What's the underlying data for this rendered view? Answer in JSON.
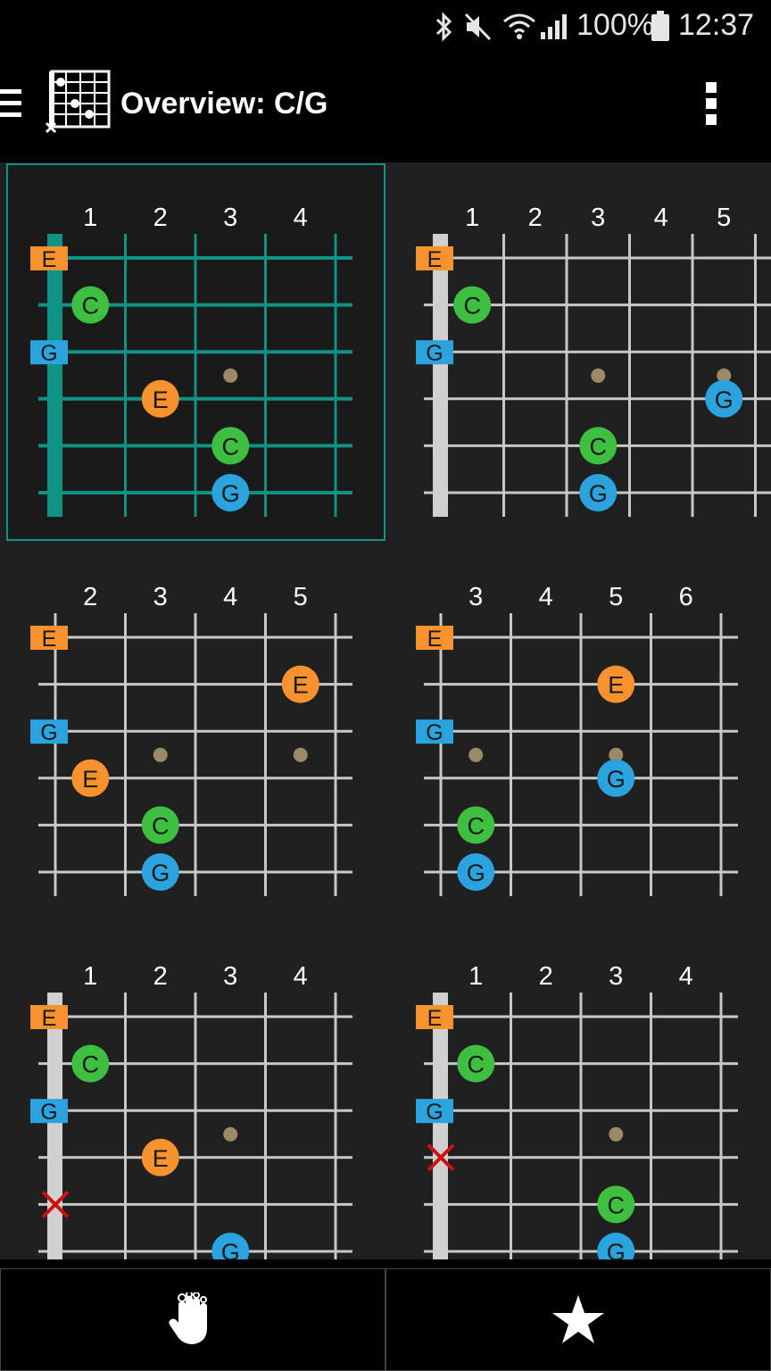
{
  "status_bar": {
    "icons": [
      "bluetooth-icon",
      "mute-icon",
      "wifi-icon",
      "signal-icon",
      "battery-icon"
    ],
    "battery": "100%",
    "time": "12:37"
  },
  "app_bar": {
    "menu_icon": "hamburger-menu-icon",
    "app_icon": "chord-diagram-icon",
    "title": "Overview: C/G",
    "overflow_icon": "more-vertical-icon"
  },
  "colors": {
    "E": "#f7922f",
    "C": "#3fbf3f",
    "G": "#2aa3de",
    "selected": "#0f9384",
    "fret": "#c8c8c8",
    "marker_dot": "#9a8a66",
    "mute_x": "#cc1111"
  },
  "open_string_labels": [
    "E",
    "",
    "G",
    "",
    "",
    ""
  ],
  "diagrams": [
    {
      "selected": true,
      "nut": true,
      "fret_numbers": [
        "1",
        "2",
        "3",
        "4"
      ],
      "inlays": [
        {
          "string": 4,
          "fret": 3
        }
      ],
      "notes": [
        {
          "string": 2,
          "fret": 1,
          "label": "C"
        },
        {
          "string": 4,
          "fret": 2,
          "label": "E"
        },
        {
          "string": 5,
          "fret": 3,
          "label": "C"
        },
        {
          "string": 6,
          "fret": 3,
          "label": "G"
        }
      ],
      "muted": []
    },
    {
      "selected": false,
      "nut": true,
      "fret_numbers": [
        "1",
        "2",
        "3",
        "4",
        "5"
      ],
      "inlays": [
        {
          "string": 4,
          "fret": 3
        },
        {
          "string": 4,
          "fret": 5
        }
      ],
      "notes": [
        {
          "string": 2,
          "fret": 1,
          "label": "C"
        },
        {
          "string": 4,
          "fret": 5,
          "label": "G"
        },
        {
          "string": 5,
          "fret": 3,
          "label": "C"
        },
        {
          "string": 6,
          "fret": 3,
          "label": "G"
        }
      ],
      "muted": []
    },
    {
      "selected": false,
      "nut": false,
      "fret_numbers": [
        "2",
        "3",
        "4",
        "5"
      ],
      "inlays": [
        {
          "string": 4,
          "fret": 2
        },
        {
          "string": 4,
          "fret": 4
        }
      ],
      "notes": [
        {
          "string": 2,
          "fret": 4,
          "label": "E"
        },
        {
          "string": 4,
          "fret": 1,
          "label": "E"
        },
        {
          "string": 5,
          "fret": 2,
          "label": "C"
        },
        {
          "string": 6,
          "fret": 2,
          "label": "G"
        }
      ],
      "muted": []
    },
    {
      "selected": false,
      "nut": false,
      "fret_numbers": [
        "3",
        "4",
        "5",
        "6"
      ],
      "inlays": [
        {
          "string": 4,
          "fret": 1
        },
        {
          "string": 4,
          "fret": 3
        }
      ],
      "notes": [
        {
          "string": 2,
          "fret": 3,
          "label": "E"
        },
        {
          "string": 4,
          "fret": 3,
          "label": "G"
        },
        {
          "string": 5,
          "fret": 1,
          "label": "C"
        },
        {
          "string": 6,
          "fret": 1,
          "label": "G"
        }
      ],
      "muted": []
    },
    {
      "selected": false,
      "nut": true,
      "fret_numbers": [
        "1",
        "2",
        "3",
        "4"
      ],
      "inlays": [
        {
          "string": 4,
          "fret": 3
        }
      ],
      "notes": [
        {
          "string": 2,
          "fret": 1,
          "label": "C"
        },
        {
          "string": 4,
          "fret": 2,
          "label": "E"
        },
        {
          "string": 6,
          "fret": 3,
          "label": "G"
        }
      ],
      "muted": [
        5
      ]
    },
    {
      "selected": false,
      "nut": true,
      "fret_numbers": [
        "1",
        "2",
        "3",
        "4"
      ],
      "inlays": [
        {
          "string": 4,
          "fret": 3
        }
      ],
      "notes": [
        {
          "string": 2,
          "fret": 1,
          "label": "C"
        },
        {
          "string": 5,
          "fret": 3,
          "label": "C"
        },
        {
          "string": 6,
          "fret": 3,
          "label": "G"
        }
      ],
      "muted": [
        4
      ]
    }
  ],
  "bottom_bar": {
    "left_icon": "hand-fingers-icon",
    "right_icon": "star-icon"
  }
}
